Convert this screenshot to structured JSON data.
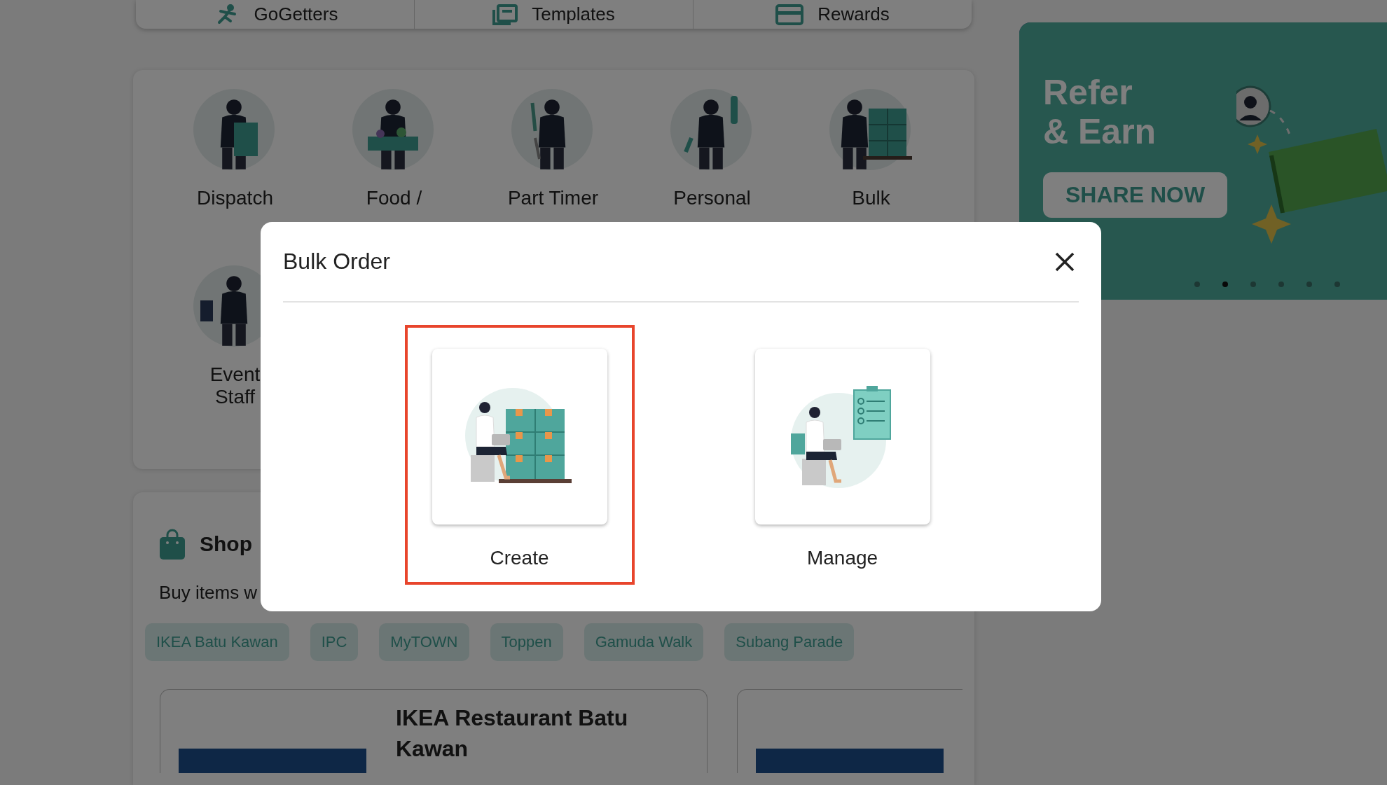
{
  "top_nav": [
    {
      "label": "GoGetters",
      "kind": "runner"
    },
    {
      "label": "Templates",
      "kind": "template"
    },
    {
      "label": "Rewards",
      "kind": "card"
    }
  ],
  "services": [
    {
      "lines": [
        "Dispatch"
      ],
      "kind": "boxes"
    },
    {
      "lines": [
        "Food /"
      ],
      "kind": "grocery"
    },
    {
      "lines": [
        "Part Timer"
      ],
      "kind": "tool"
    },
    {
      "lines": [
        "Personal"
      ],
      "kind": "duster"
    },
    {
      "lines": [
        "Bulk"
      ],
      "kind": "bulk"
    },
    {
      "lines": [
        "Event",
        "Staff"
      ],
      "kind": "event"
    }
  ],
  "banner": {
    "title_lines": [
      "Refer",
      "& Earn"
    ],
    "button": "SHARE NOW",
    "dots": [
      {
        "selected": false
      },
      {
        "selected": true
      },
      {
        "selected": false
      },
      {
        "selected": false
      },
      {
        "selected": false
      },
      {
        "selected": false
      }
    ]
  },
  "shop": {
    "title": "Shop",
    "description": "Buy items w",
    "chips": [
      "IKEA Batu Kawan",
      "IPC",
      "MyTOWN",
      "Toppen",
      "Gamuda Walk",
      "Subang Parade"
    ],
    "stores": [
      {
        "name": "IKEA Restaurant Batu Kawan"
      }
    ]
  },
  "modal": {
    "title": "Bulk Order",
    "options": [
      {
        "label": "Create",
        "kind": "create",
        "selected": true
      },
      {
        "label": "Manage",
        "kind": "manage",
        "selected": false
      }
    ]
  }
}
